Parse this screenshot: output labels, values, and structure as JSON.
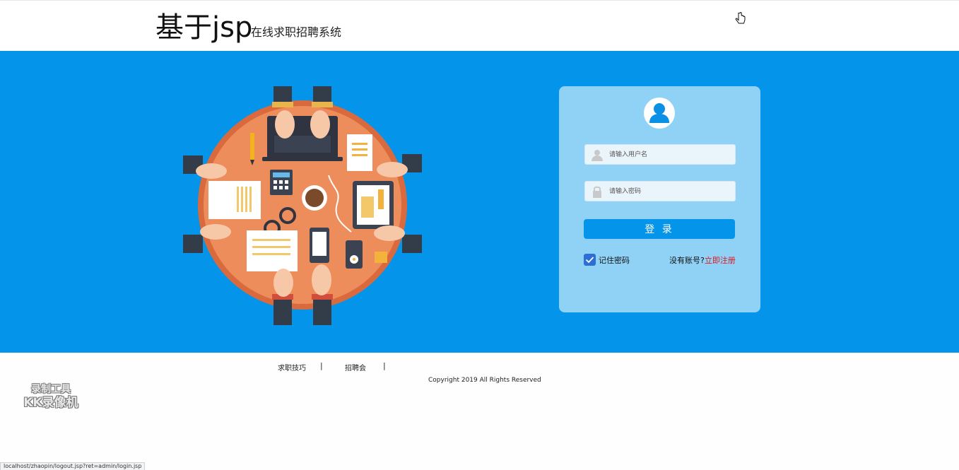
{
  "header": {
    "title_main": "基于jsp",
    "title_sub": "在线求职招聘系统"
  },
  "login": {
    "username_placeholder": "请输入用户名",
    "password_placeholder": "请输入密码",
    "login_button": "登 录",
    "remember_label": "记住密码",
    "remember_checked": true,
    "no_account_text": "没有账号?",
    "register_link": "立即注册"
  },
  "footer": {
    "nav": [
      {
        "label": "求职技巧"
      },
      {
        "label": "招聘会"
      }
    ],
    "copyright": "Copyright 2019 All Rights Reserved"
  },
  "watermark": {
    "line1": "录制工具",
    "line2": "KK录像机"
  },
  "status_bar": {
    "url": "localhost/zhaopin/logout.jsp?ret=admin/login.jsp"
  },
  "colors": {
    "banner": "#0494ea",
    "card": "#90d2f6",
    "button": "#0494ea",
    "register_link": "#e0151b",
    "checkbox": "#2d6ed4"
  },
  "icons": [
    "cursor-hand-icon",
    "user-avatar-icon",
    "user-icon",
    "lock-icon",
    "check-icon"
  ]
}
